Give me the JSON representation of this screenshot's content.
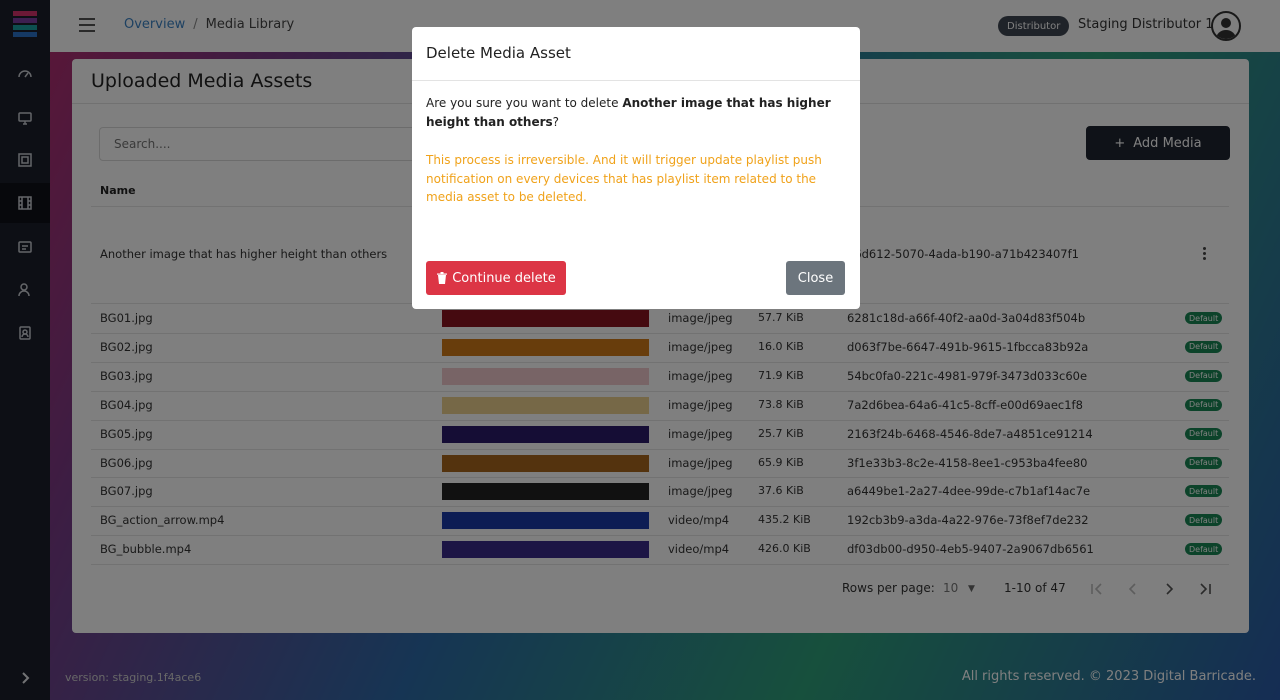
{
  "header": {
    "breadcrumb": {
      "home": "Overview",
      "separator": "/",
      "current": "Media Library"
    },
    "role_badge": "Distributor",
    "user_name": "Staging Distributor 1"
  },
  "card": {
    "title": "Uploaded Media Assets",
    "search_placeholder": "Search....",
    "add_button_label": "Add Media",
    "columns": {
      "name": "Name"
    },
    "first_row": {
      "name": "Another image that has higher height than others",
      "id": "96d612-5070-4ada-b190-a71b423407f1"
    },
    "rows": [
      {
        "name": "BG01.jpg",
        "type": "image/jpeg",
        "size": "57.7 KiB",
        "id": "6281c18d-a66f-40f2-aa0d-3a04d83f504b",
        "badge": "Default",
        "thumb_color": "#8b1420"
      },
      {
        "name": "BG02.jpg",
        "type": "image/jpeg",
        "size": "16.0 KiB",
        "id": "d063f7be-6647-491b-9615-1fbcca83b92a",
        "badge": "Default",
        "thumb_color": "#d07a18"
      },
      {
        "name": "BG03.jpg",
        "type": "image/jpeg",
        "size": "71.9 KiB",
        "id": "54bc0fa0-221c-4981-979f-3473d033c60e",
        "badge": "Default",
        "thumb_color": "#f1c9cc"
      },
      {
        "name": "BG04.jpg",
        "type": "image/jpeg",
        "size": "73.8 KiB",
        "id": "7a2d6bea-64a6-41c5-8cff-e00d69aec1f8",
        "badge": "Default",
        "thumb_color": "#ecd18e"
      },
      {
        "name": "BG05.jpg",
        "type": "image/jpeg",
        "size": "25.7 KiB",
        "id": "2163f24b-6468-4546-8de7-a4851ce91214",
        "badge": "Default",
        "thumb_color": "#2a1a6a"
      },
      {
        "name": "BG06.jpg",
        "type": "image/jpeg",
        "size": "65.9 KiB",
        "id": "3f1e33b3-8c2e-4158-8ee1-c953ba4fee80",
        "badge": "Default",
        "thumb_color": "#a8661c"
      },
      {
        "name": "BG07.jpg",
        "type": "image/jpeg",
        "size": "37.6 KiB",
        "id": "a6449be1-2a27-4dee-99de-c7b1af14ac7e",
        "badge": "Default",
        "thumb_color": "#222222"
      },
      {
        "name": "BG_action_arrow.mp4",
        "type": "video/mp4",
        "size": "435.2 KiB",
        "id": "192cb3b9-a3da-4a22-976e-73f8ef7de232",
        "badge": "Default",
        "thumb_color": "#1a3aa8"
      },
      {
        "name": "BG_bubble.mp4",
        "type": "video/mp4",
        "size": "426.0 KiB",
        "id": "df03db00-d950-4eb5-9407-2a9067db6561",
        "badge": "Default",
        "thumb_color": "#3a2a8a"
      }
    ],
    "pagination": {
      "rows_per_page_label": "Rows per page:",
      "rows_per_page_value": "10",
      "range": "1-10 of 47"
    }
  },
  "footer": {
    "version": "version: staging.1f4ace6",
    "copyright": "All rights reserved. © 2023 Digital Barricade."
  },
  "modal": {
    "title": "Delete Media Asset",
    "question_prefix": "Are you sure you want to delete ",
    "question_target": "Another image that has higher height than others",
    "question_suffix": "?",
    "warning": "This process is irreversible. And it will trigger update playlist push notification on every devices that has playlist item related to the media asset to be deleted.",
    "delete_button": "Continue delete",
    "close_button": "Close"
  },
  "colors": {
    "danger": "#dc3545",
    "warning_text": "#f0a21a",
    "default_badge": "#198754",
    "sidebar": "#1b1f2a"
  }
}
